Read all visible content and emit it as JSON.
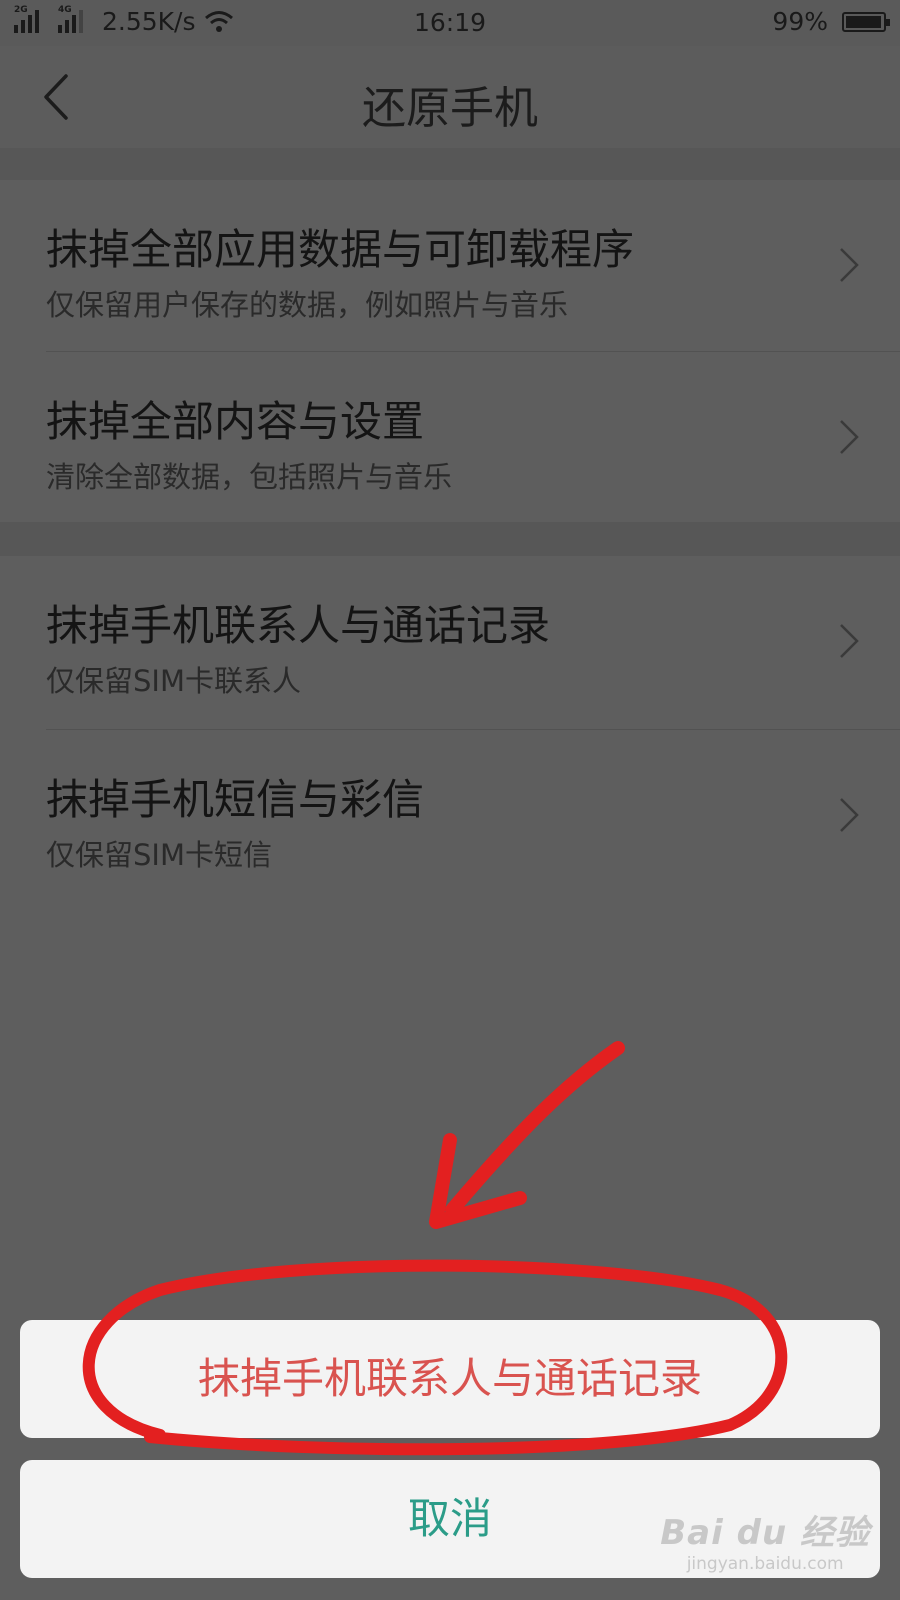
{
  "status_bar": {
    "signal_1_label": "2G",
    "signal_2_label": "4G",
    "network_speed": "2.55K/s",
    "time": "16:19",
    "battery_percent": "99%"
  },
  "header": {
    "title": "还原手机",
    "back_icon": "chevron-left-icon"
  },
  "groups": [
    {
      "items": [
        {
          "title": "抹掉全部应用数据与可卸载程序",
          "subtitle": "仅保留用户保存的数据，例如照片与音乐"
        },
        {
          "title": "抹掉全部内容与设置",
          "subtitle": "清除全部数据，包括照片与音乐"
        }
      ]
    },
    {
      "items": [
        {
          "title": "抹掉手机联系人与通话记录",
          "subtitle": "仅保留SIM卡联系人"
        },
        {
          "title": "抹掉手机短信与彩信",
          "subtitle": "仅保留SIM卡短信"
        }
      ]
    }
  ],
  "action_sheet": {
    "confirm_label": "抹掉手机联系人与通话记录",
    "cancel_label": "取消"
  },
  "watermark": {
    "brand": "Bai du 经验",
    "url": "jingyan.baidu.com"
  },
  "colors": {
    "dim_background": "#5e5e5e",
    "sheet_background": "#f3f3f3",
    "danger_text": "#d9534f",
    "cancel_text": "#2b9c88",
    "annotation_red": "#e32020"
  }
}
